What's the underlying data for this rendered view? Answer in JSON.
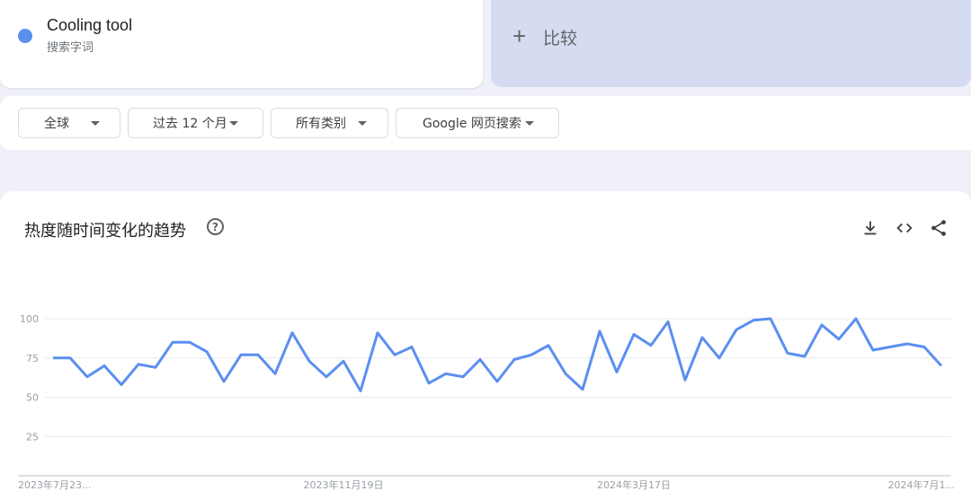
{
  "search_term": {
    "name": "Cooling tool",
    "type": "搜索字词",
    "color": "#5b8ff0"
  },
  "compare": {
    "plus": "+",
    "label": "比较"
  },
  "filters": [
    {
      "label": "全球"
    },
    {
      "label": "过去 12 个月"
    },
    {
      "label": "所有类别"
    },
    {
      "label": "Google 网页搜索"
    }
  ],
  "chart": {
    "title": "热度随时间变化的趋势",
    "help": "?",
    "toolbar": [
      "download-icon",
      "embed-icon",
      "share-icon"
    ]
  },
  "colors": {
    "accent": "#5b8ff0",
    "compare_bg": "#d5dcf2",
    "page_bg": "#f0f1f8"
  },
  "chart_data": {
    "type": "line",
    "title": "热度随时间变化的趋势",
    "ylim": [
      0,
      100
    ],
    "yticks": [
      "100",
      "75",
      "50",
      "25"
    ],
    "ytick_values": [
      100,
      75,
      50,
      25
    ],
    "xtick_labels": [
      "2023年7月23...",
      "2023年11月19日",
      "2024年3月17日",
      "2024年7月1..."
    ],
    "xtick_index": [
      0,
      17,
      34,
      52
    ],
    "grid": true,
    "series": [
      {
        "name": "Cooling tool",
        "color": "#5b8ff0",
        "values": [
          75,
          75,
          63,
          70,
          58,
          71,
          69,
          85,
          85,
          79,
          60,
          77,
          77,
          65,
          91,
          73,
          63,
          73,
          54,
          91,
          77,
          82,
          59,
          65,
          63,
          74,
          60,
          74,
          77,
          83,
          65,
          55,
          92,
          66,
          90,
          83,
          98,
          61,
          88,
          75,
          93,
          99,
          100,
          78,
          76,
          96,
          87,
          100,
          80,
          82,
          84,
          82,
          70
        ]
      }
    ]
  }
}
